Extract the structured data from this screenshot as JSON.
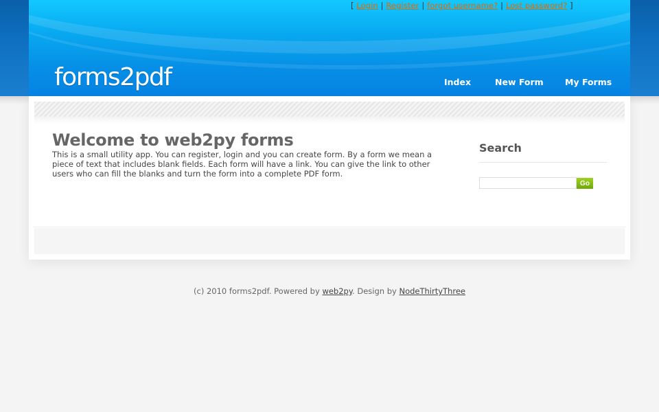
{
  "toplinks": {
    "open": "[",
    "close": "]",
    "sep": "|",
    "items": [
      "Login",
      "Register",
      "forgot username?",
      "Lost password?"
    ]
  },
  "site": {
    "logo": "forms2pdf"
  },
  "nav": {
    "items": [
      "Index",
      "New Form",
      "My Forms"
    ]
  },
  "main": {
    "title": "Welcome to web2py forms",
    "text": "This is a small utility app. You can register, login and you can create form. By a form we mean a piece of text that includes blank fields. Each form will have a link. You can give the link to other users who can fill the blanks and turn the form into a complete PDF form."
  },
  "sidebar": {
    "search_title": "Search",
    "search_value": "",
    "go_label": "Go"
  },
  "footer": {
    "prefix": "(c) 2010 forms2pdf. Powered by ",
    "web2py": "web2py",
    "middle": ". Design by ",
    "designer": "NodeThirtyThree"
  },
  "colors": {
    "header_blue": "#08a8f0",
    "link_orange": "#e06a00",
    "go_green": "#7cb50f"
  }
}
